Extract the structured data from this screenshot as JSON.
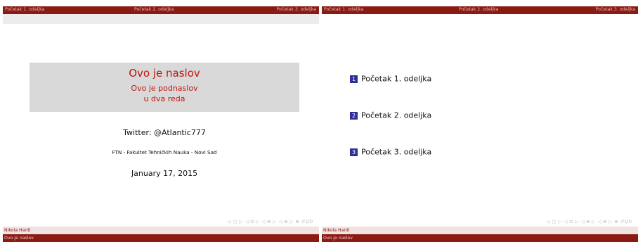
{
  "header": {
    "sections": [
      "Početak 1. odeljka",
      "Početak 2. odeljka",
      "Početak 3. odeljka"
    ]
  },
  "footer": {
    "author": "Nikola Hardi",
    "short_title": "Ovo je naslov"
  },
  "title_slide": {
    "title": "Ovo je naslov",
    "subtitle_line1": "Ovo je podnaslov",
    "subtitle_line2": "u dva reda",
    "author": "Twitter: @Atlantic777",
    "institute": "FTN - Fakultet Tehničkih Nauka - Novi Sad",
    "date": "January 17, 2015"
  },
  "toc_slide": {
    "items": [
      {
        "number": "1",
        "label": "Početak 1. odeljka"
      },
      {
        "number": "2",
        "label": "Početak 2. odeljka"
      },
      {
        "number": "3",
        "label": "Početak 3. odeljka"
      }
    ]
  },
  "nav_symbols": "◁ ▢ ▷ ◁ ⊡ ▷ ◁ ≣ ▷ ◁ ≣ ▷ ≣ ↺Q↻",
  "colors": {
    "bar": "#8b1a12",
    "title_red": "#c0140c",
    "toc_box": "#2f2f9b",
    "title_box": "#d9d9d9"
  }
}
